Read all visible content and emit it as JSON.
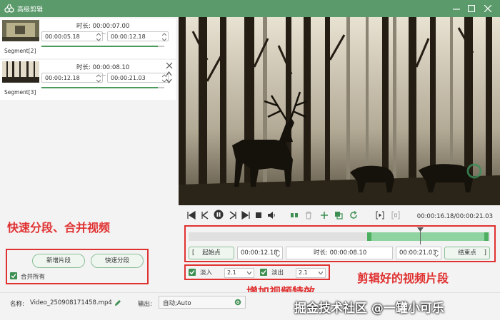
{
  "window": {
    "title": "高级剪辑"
  },
  "segments": [
    {
      "label": "Segment[2]",
      "duration_label": "时长:",
      "duration": "00:00:07.00",
      "start": "00:00:05.18",
      "end": "00:00:12.18",
      "progress": 0.95
    },
    {
      "label": "Segment[3]",
      "duration_label": "时长:",
      "duration": "00:00:08.10",
      "start": "00:00:12.18",
      "end": "00:00:21.03",
      "progress": 0.95
    }
  ],
  "annotations": {
    "fast_split": "快速分段、合并视频",
    "trimmed": "剪辑好的视频片段",
    "effects": "增加视频特效"
  },
  "left_actions": {
    "add_segment": "新增片段",
    "quick_split": "快速分段",
    "merge_all": "合并所有"
  },
  "player": {
    "time_readout": "00:00:16.18/00:00:21.03"
  },
  "trim": {
    "start_button": "起始点",
    "start_time": "00:00:12.18",
    "duration_label": "时长:",
    "duration": "00:00:08.10",
    "end_time": "00:00:21.03",
    "end_button": "结束点"
  },
  "effects": {
    "fade_in_label": "淡入",
    "fade_in_value": "2.1",
    "fade_out_label": "淡出",
    "fade_out_value": "2.1"
  },
  "footer": {
    "name_label": "名称:",
    "name_value": "Video_250908171458.mp4",
    "output_label": "输出:",
    "output_value": "自动;Auto"
  },
  "watermark": "掘金技术社区 @一罐小可乐",
  "colors": {
    "accent": "#5b9a6b",
    "highlight": "#e03131",
    "selection": "#8fd3a0"
  }
}
